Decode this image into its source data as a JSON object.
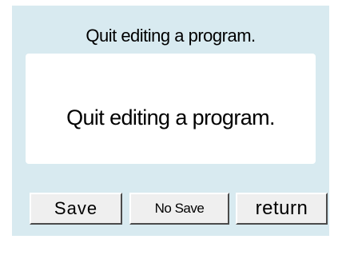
{
  "dialog": {
    "title": "Quit editing a program.",
    "message": "Quit editing a program."
  },
  "buttons": {
    "save_label": "Save",
    "no_save_label": "No Save",
    "return_label": "return"
  },
  "colors": {
    "dialog_background": "#d8eaf0",
    "message_background": "#ffffff",
    "button_face": "#efefef"
  }
}
